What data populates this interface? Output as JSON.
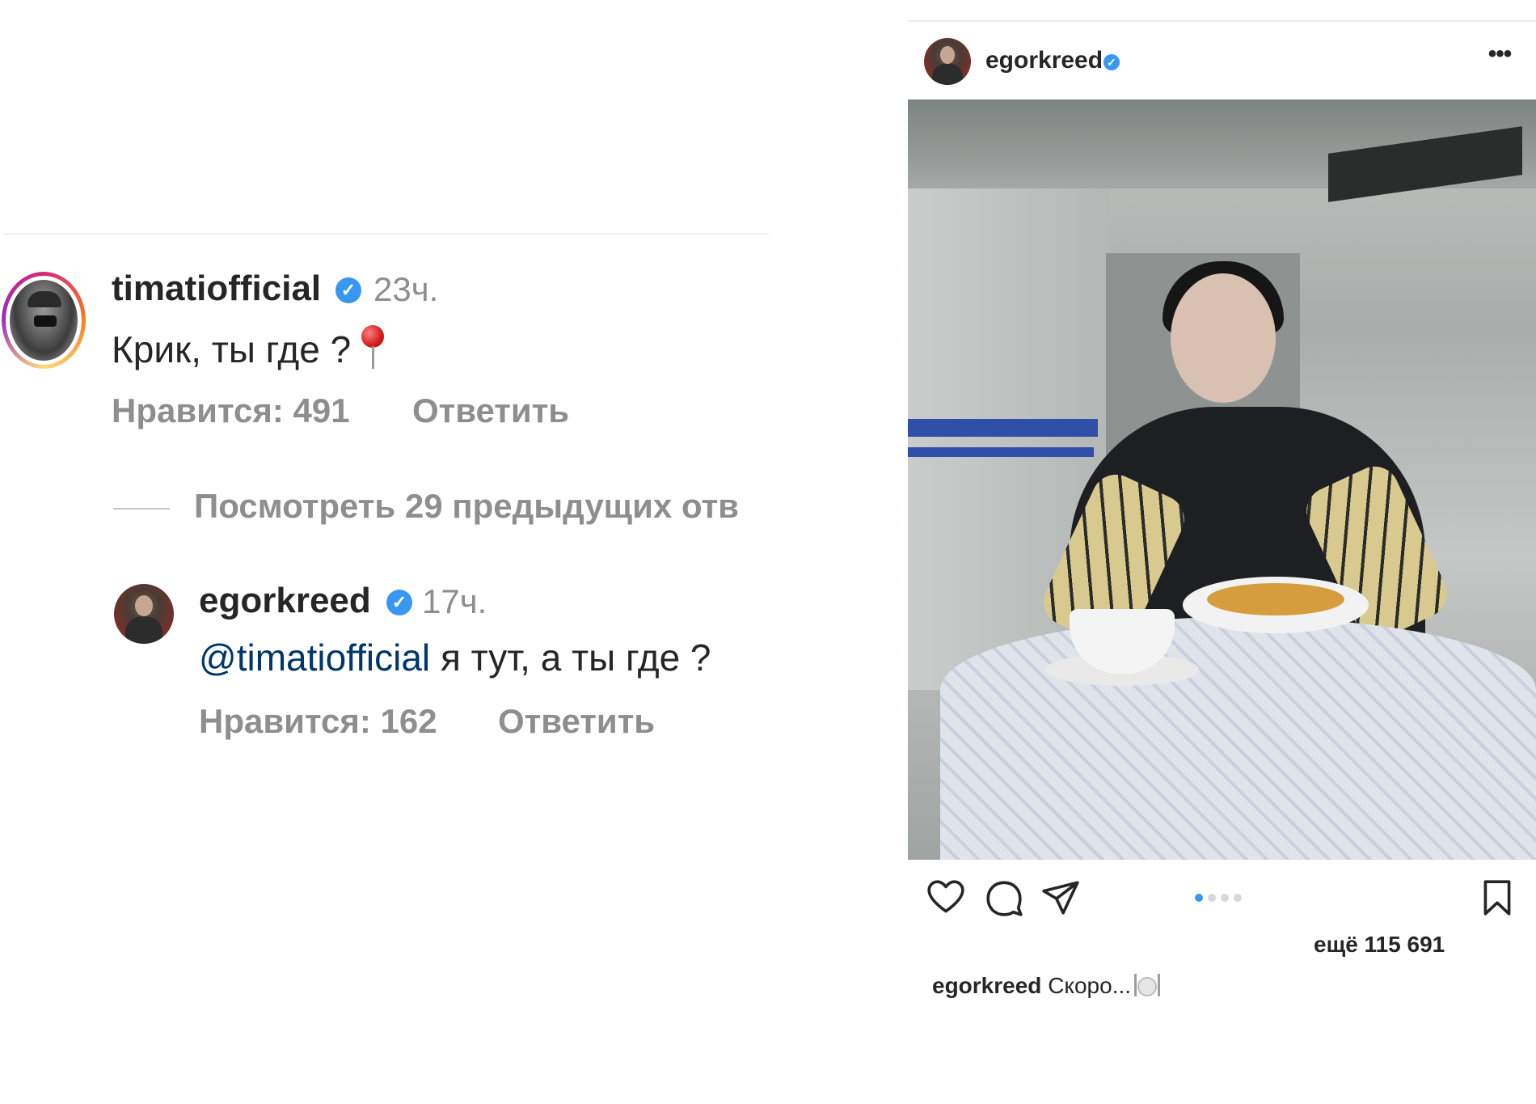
{
  "comments": [
    {
      "username": "timatiofficial",
      "time": "23ч.",
      "text": "Крик, ты где ?",
      "likes": "Нравится: 491",
      "reply": "Ответить"
    },
    {
      "username": "egorkreed",
      "time": "17ч.",
      "mention": "@timatiofficial",
      "text": "я тут, а ты где ?",
      "likes": "Нравится: 162",
      "reply": "Ответить"
    }
  ],
  "view_previous": "Посмотреть 29 предыдущих отв",
  "post": {
    "username": "egorkreed",
    "more_icon": "more-horizontal-icon",
    "likes_more": "ещё 115 691",
    "caption_user": "egorkreed",
    "caption_text": "Скоро...",
    "carousel_total": 4,
    "carousel_active": 1,
    "actions": [
      "heart-icon",
      "comment-icon",
      "share-icon",
      "bookmark-icon"
    ]
  },
  "colors": {
    "verified": "#3897f0",
    "mention": "#00376b",
    "secondary_text": "#8e8e8e",
    "primary_text": "#262626"
  }
}
